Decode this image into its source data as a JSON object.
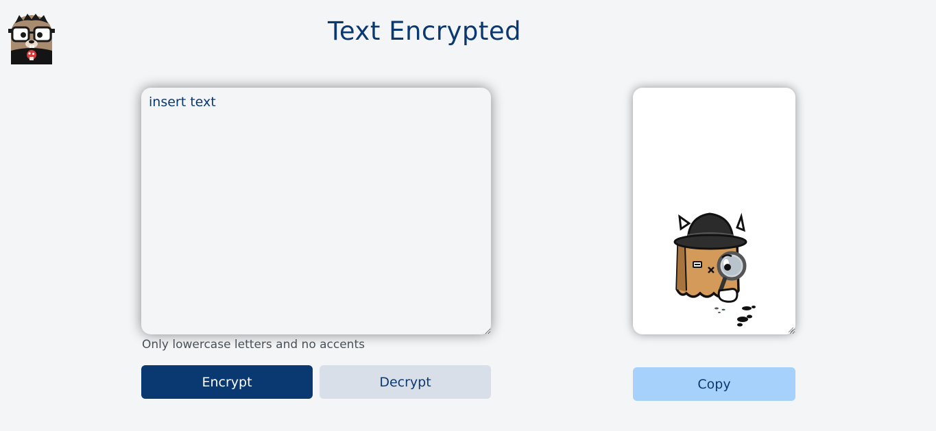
{
  "header": {
    "title": "Text Encrypted",
    "logo_icon": "gopher-glasses-logo-icon"
  },
  "input": {
    "placeholder": "insert text",
    "value": "",
    "hint": "Only lowercase letters and no accents"
  },
  "actions": {
    "encrypt_label": "Encrypt",
    "decrypt_label": "Decrypt"
  },
  "output": {
    "illustration_icon": "detective-magnifier-illustration-icon",
    "copy_label": "Copy"
  },
  "colors": {
    "background": "#f3f5f7",
    "primary": "#0a3871",
    "secondary_button": "#d8dfe8",
    "copy_button": "#a6d1fa",
    "hint_text": "#495057"
  }
}
